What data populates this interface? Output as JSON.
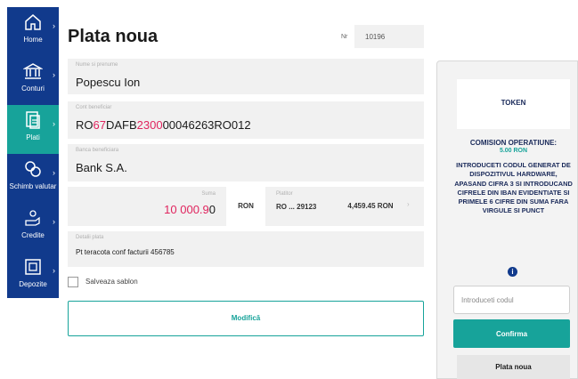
{
  "sidebar": {
    "items": [
      {
        "label": "Home",
        "icon": "home-icon",
        "active": false
      },
      {
        "label": "Conturi",
        "icon": "bank-icon",
        "active": false
      },
      {
        "label": "Plati",
        "icon": "payments-icon",
        "active": true
      },
      {
        "label": "Schimb valutar",
        "icon": "currency-exchange-icon",
        "active": false
      },
      {
        "label": "Credite",
        "icon": "credit-icon",
        "active": false
      },
      {
        "label": "Depozite",
        "icon": "deposit-icon",
        "active": false
      }
    ]
  },
  "header": {
    "title": "Plata noua",
    "nr_label": "Nr",
    "nr_value": "10196"
  },
  "form": {
    "beneficiary": {
      "label": "Nume si prenume",
      "value": "Popescu Ion"
    },
    "iban": {
      "label": "Cont beneficiar",
      "part1": "RO",
      "part2": "67",
      "part3": "DAFB",
      "part4": "2300",
      "part5": "00046263RO012"
    },
    "bank": {
      "label": "Banca beneficiara",
      "value": "Bank S.A."
    },
    "amount": {
      "label": "Suma",
      "value_main": "10 000.9",
      "value_last": "0"
    },
    "currency": "RON",
    "account": {
      "label": "Platitor",
      "value": "RO ... 29123"
    },
    "balance": "4,459.45 RON",
    "details": {
      "label": "Detalii plata",
      "value": "Pt teracota conf facturii 456785"
    },
    "save_template_label": "Salveaza sablon",
    "modify_label": "Modifică"
  },
  "panel": {
    "token_title": "TOKEN",
    "fee_title": "COMISION OPERATIUNE:",
    "fee_value": "5.00 RON",
    "instructions": "INTRODUCETI CODUL GENERAT DE DISPOZITIVUL HARDWARE, APASAND CIFRA 3 SI INTRODUCAND CIFRELE DIN IBAN EVIDENTIATE SI PRIMELE 6 CIFRE DIN SUMA FARA VIRGULE SI PUNCT",
    "info_symbol": "i",
    "code_placeholder": "Introduceti codul",
    "confirm_label": "Confirma",
    "new_payment_label": "Plata noua"
  },
  "colors": {
    "sidebar": "#113a8c",
    "accent": "#17a39a",
    "highlight": "#e0245e"
  }
}
